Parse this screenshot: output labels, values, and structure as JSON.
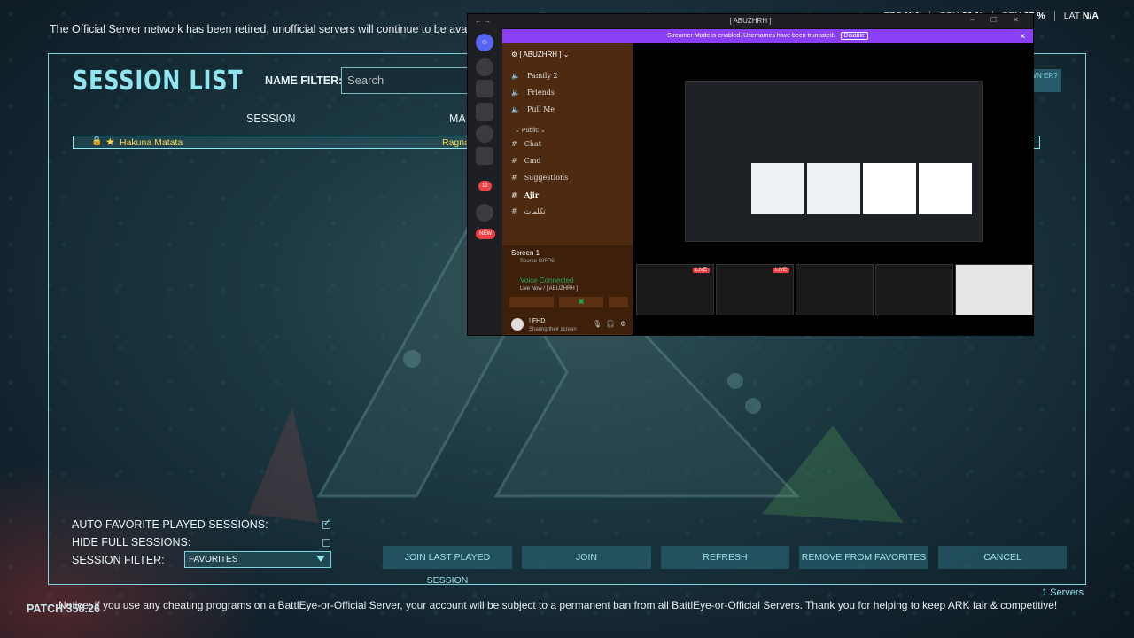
{
  "notice_top": "The Official Server network has been retired, unofficial servers will continue to be availa",
  "overlay": {
    "fps_label": "FPS",
    "fps": "N/A",
    "gpu_label": "GPU",
    "gpu": "36 %",
    "cpu_label": "CPU",
    "cpu": "37 %",
    "lat_label": "LAT",
    "lat": "N/A"
  },
  "session_list": {
    "title": "SESSION LIST",
    "name_filter_label": "NAME FILTER:",
    "search_placeholder": "Search",
    "col_session": "SESSION",
    "col_map": "MA",
    "row": {
      "name": "Hakuna Matata",
      "map": "Ragna"
    },
    "top_right_btn": "OWN\nER?"
  },
  "options": {
    "auto_favorite": "AUTO FAVORITE PLAYED SESSIONS:",
    "auto_favorite_checked": true,
    "hide_full": "HIDE FULL SESSIONS:",
    "hide_full_checked": false,
    "session_filter": "SESSION FILTER:",
    "session_filter_value": "FAVORITES"
  },
  "buttons": {
    "join_last": "JOIN LAST PLAYED SESSION",
    "join": "JOIN",
    "refresh": "REFRESH",
    "remove_fav": "REMOVE FROM FAVORITES",
    "cancel": "CANCEL"
  },
  "servers_count": "1 Servers",
  "notice_bottom": "Notice: if you use any cheating programs on a BattlEye-or-Official Server, your account will be subject to a permanent ban from all BattlEye-or-Official Servers. Thank you for helping to keep ARK fair & competitive!",
  "patch": "PATCH 358.26",
  "discord": {
    "window_title": "[ ABUZHRH ]",
    "banner": "Streamer Mode is enabled. Usernames have been truncated.",
    "banner_btn": "Disable",
    "server_name": "[ ABUZHRH ]",
    "channels_top": [
      "Family 2",
      "Friends",
      "Pull Me"
    ],
    "category": "Public",
    "channels": [
      "Chat",
      "Cmd",
      "Suggestions",
      "Ajir",
      "تكلمات"
    ],
    "screen_label": "Screen 1",
    "screen_sub": "Source 60FPS",
    "voice_connected": "Voice Connected",
    "voice_channel": "Live Now / [ ABUZHRH ]",
    "user_name": "! FHD",
    "user_status": "Sharing their screen",
    "badge_12": "12",
    "badge_new": "NEW",
    "live": "LIVE"
  },
  "colors": {
    "accent": "#8fe6f0",
    "gold": "#ffd54a",
    "discord_purple": "#8a3ff5"
  }
}
